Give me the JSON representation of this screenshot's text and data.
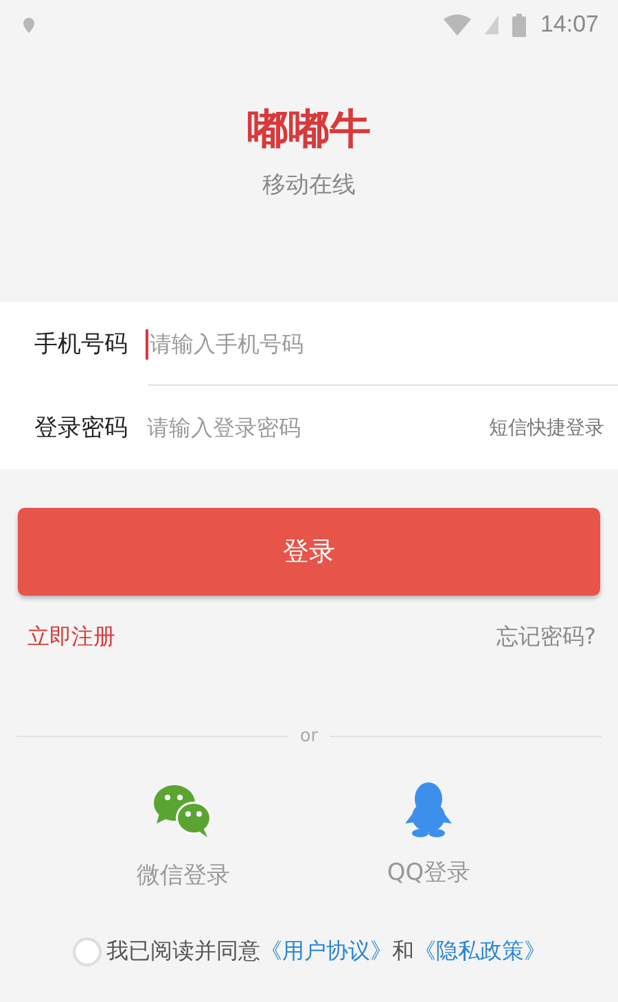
{
  "status_bar": {
    "time": "14:07"
  },
  "app": {
    "name": "嘟嘟牛",
    "tagline": "移动在线"
  },
  "fields": [
    {
      "label": "手机号码",
      "placeholder": "请输入手机号码",
      "focused": true
    },
    {
      "label": "登录密码",
      "placeholder": "请输入登录密码",
      "focused": false,
      "action": "短信快捷登录"
    }
  ],
  "login_button": "登录",
  "register_link": "立即注册",
  "forgot_link": "忘记密码?",
  "divider_text": "or",
  "social": [
    {
      "kind": "wechat",
      "label": "微信登录"
    },
    {
      "kind": "qq",
      "label": "QQ登录"
    }
  ],
  "agreement": {
    "checked": false,
    "text": "我已阅读并同意",
    "link_1": "《用户协议》",
    "joiner": "和",
    "link_2": "《隐私政策》"
  }
}
